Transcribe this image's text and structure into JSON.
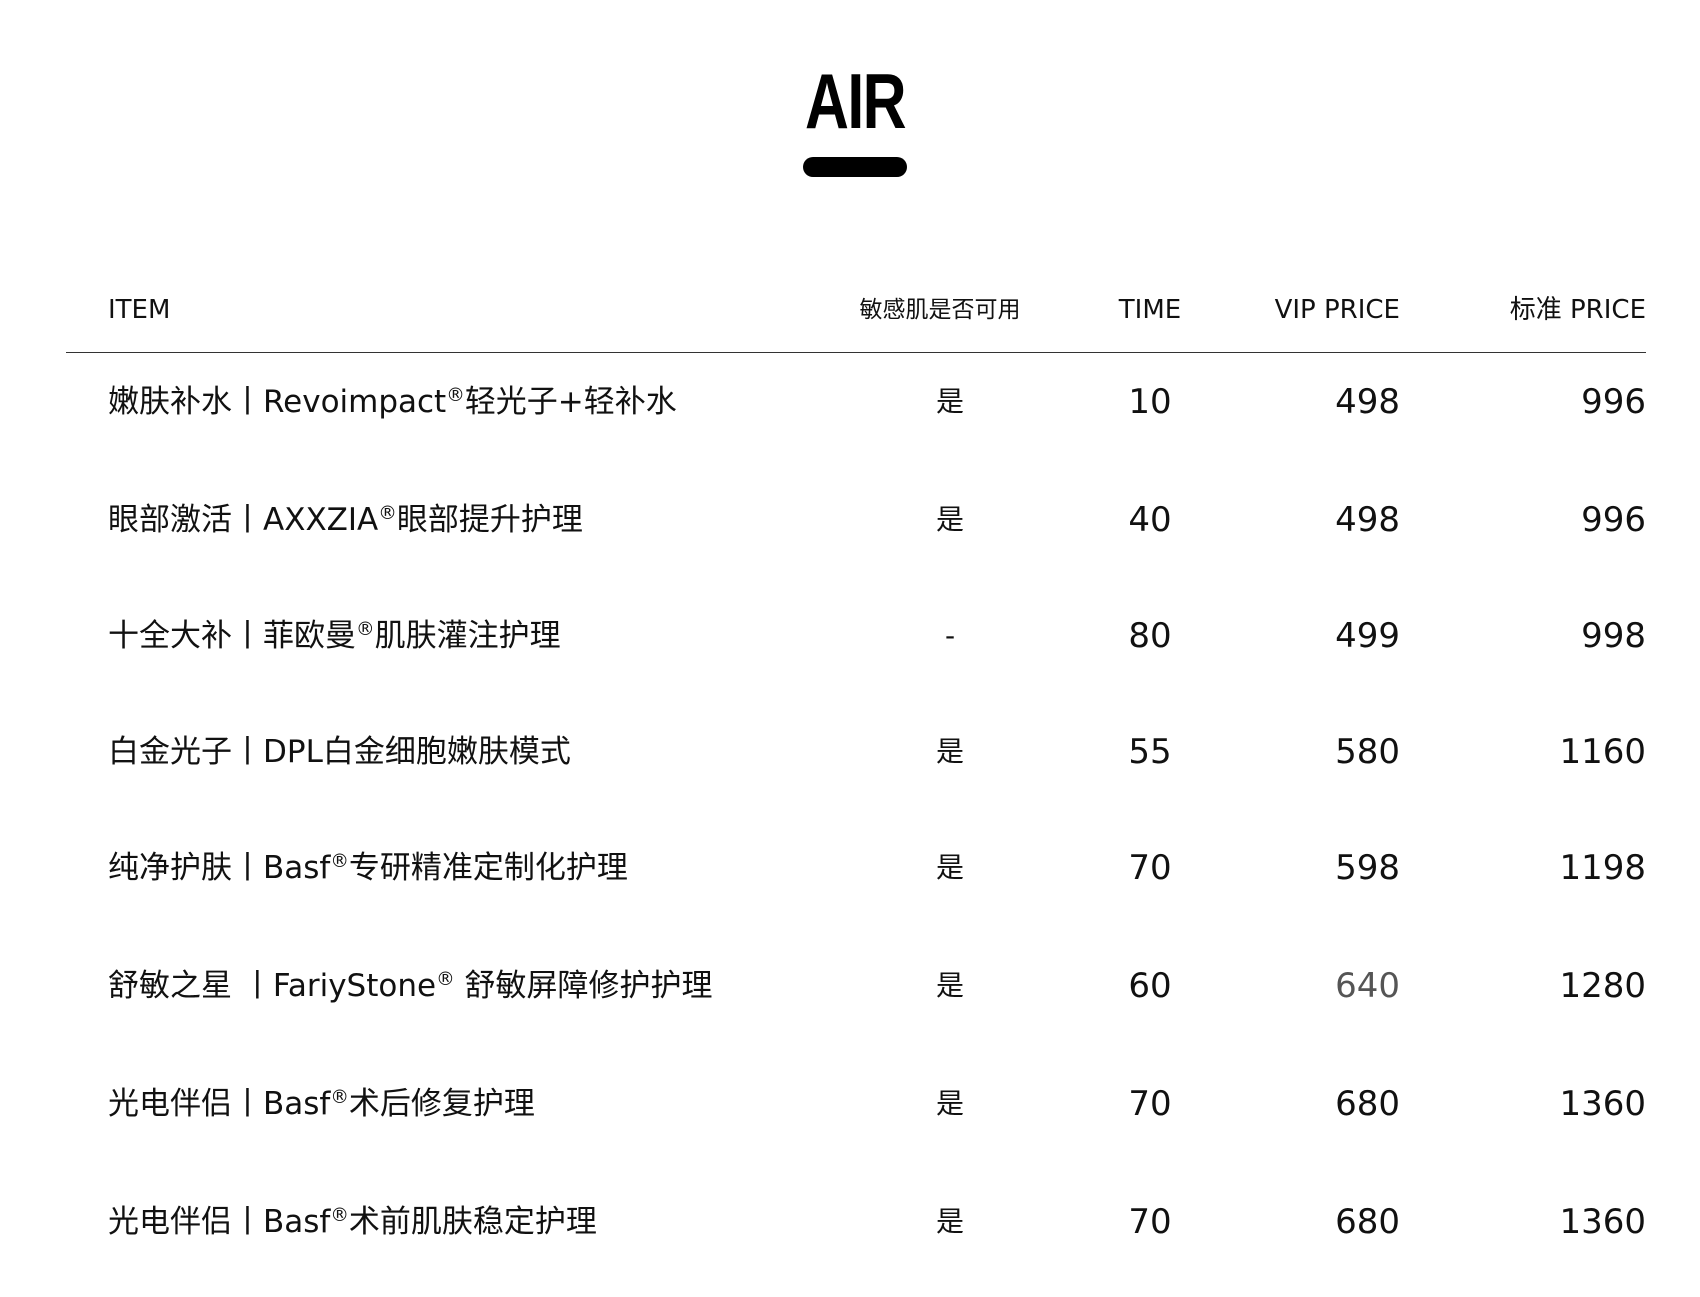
{
  "title": "AIR",
  "headers": {
    "item": "ITEM",
    "sensitive": "敏感肌是否可用",
    "time": "TIME",
    "vip_price": "VIP PRICE",
    "std_price": "标准 PRICE"
  },
  "rows": [
    {
      "item_a": "嫩肤补水丨Revoimpact",
      "reg": "®",
      "item_b": "轻光子+轻补水",
      "sensitive": "是",
      "time": "10",
      "vip": "498",
      "std": "996"
    },
    {
      "item_a": "眼部激活丨AXXZIA",
      "reg": "®",
      "item_b": "眼部提升护理",
      "sensitive": "是",
      "time": "40",
      "vip": "498",
      "std": "996"
    },
    {
      "item_a": "十全大补丨菲欧曼",
      "reg": "®",
      "item_b": "肌肤灌注护理",
      "sensitive": "-",
      "time": "80",
      "vip": "499",
      "std": "998"
    },
    {
      "item_a": "白金光子丨DPL白金细胞嫩肤模式",
      "reg": "",
      "item_b": "",
      "sensitive": "是",
      "time": "55",
      "vip": "580",
      "std": "1160"
    },
    {
      "item_a": "纯净护肤丨Basf",
      "reg": "®",
      "item_b": "专研精准定制化护理",
      "sensitive": "是",
      "time": "70",
      "vip": "598",
      "std": "1198"
    },
    {
      "item_a": "舒敏之星 丨FariyStone",
      "reg": "®",
      "item_b": " 舒敏屏障修护护理",
      "sensitive": "是",
      "time": "60",
      "vip": "640",
      "std": "1280"
    },
    {
      "item_a": "光电伴侣丨Basf",
      "reg": "®",
      "item_b": "术后修复护理",
      "sensitive": "是",
      "time": "70",
      "vip": "680",
      "std": "1360"
    },
    {
      "item_a": "光电伴侣丨Basf",
      "reg": "®",
      "item_b": "术前肌肤稳定护理",
      "sensitive": "是",
      "time": "70",
      "vip": "680",
      "std": "1360"
    }
  ]
}
